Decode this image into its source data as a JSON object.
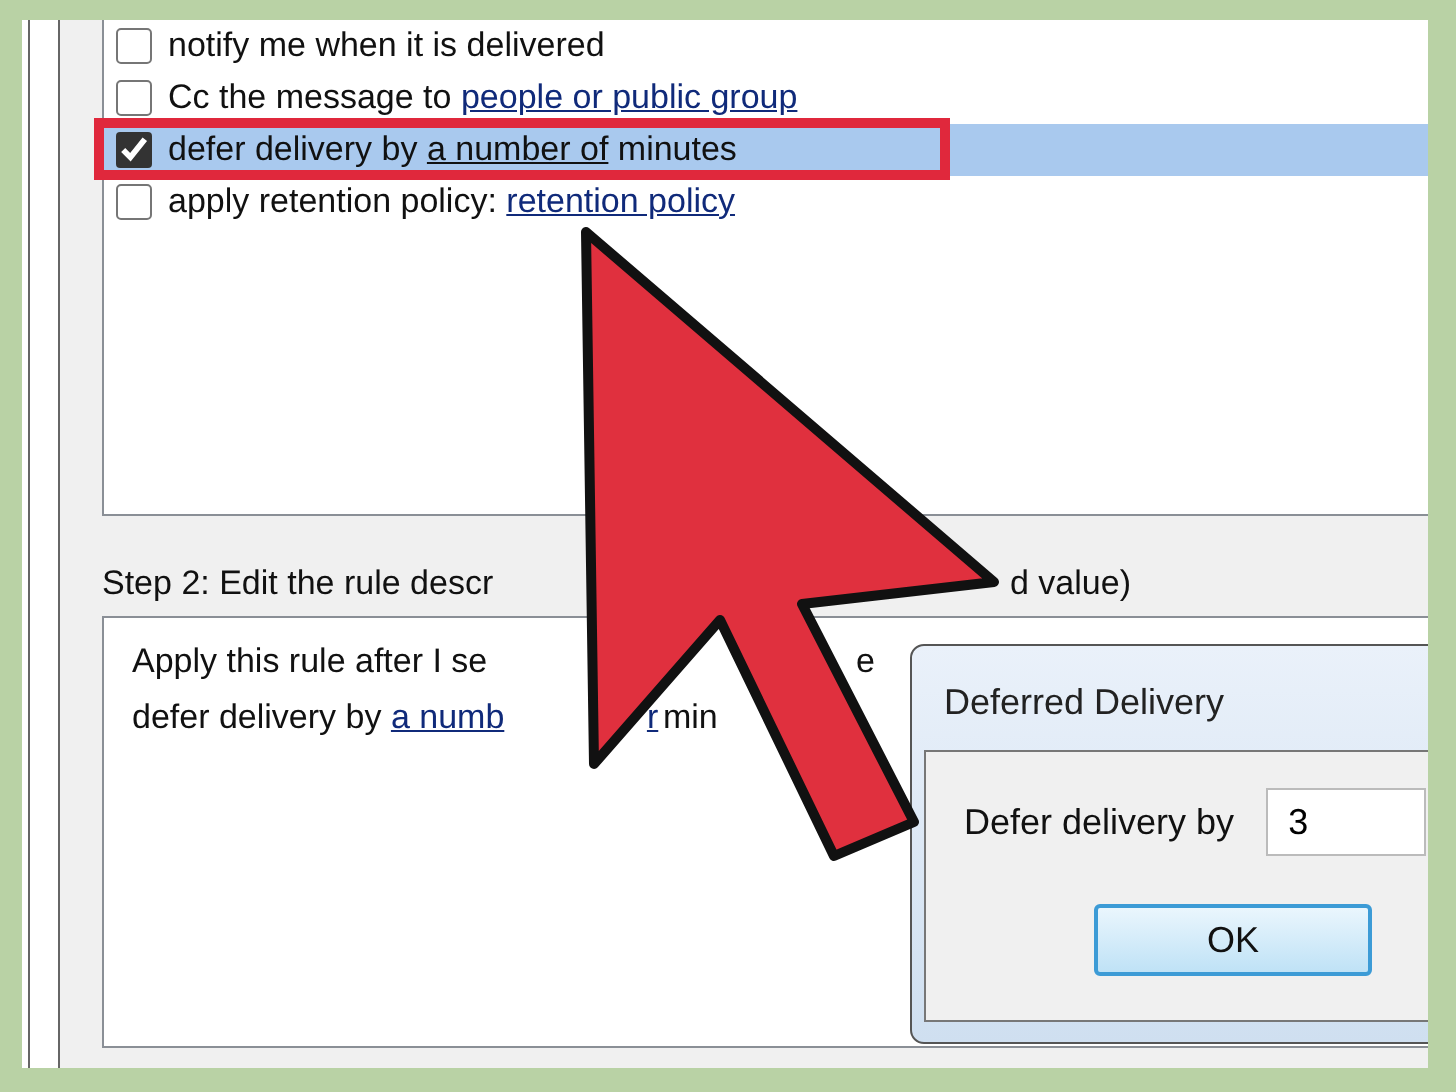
{
  "rules_list": {
    "items": [
      {
        "checked": false,
        "selected": false,
        "parts": [
          {
            "text": "notify me when it is delivered",
            "link": false
          }
        ]
      },
      {
        "checked": false,
        "selected": false,
        "parts": [
          {
            "text": "Cc the message to ",
            "link": false
          },
          {
            "text": "people or public group",
            "link": true
          }
        ]
      },
      {
        "checked": true,
        "selected": true,
        "parts": [
          {
            "text": "defer delivery by ",
            "link": false
          },
          {
            "text": "a number of",
            "link": true
          },
          {
            "text": " minutes",
            "link": false
          }
        ]
      },
      {
        "checked": false,
        "selected": false,
        "parts": [
          {
            "text": "apply retention policy: ",
            "link": false
          },
          {
            "text": "retention policy",
            "link": true
          }
        ]
      }
    ]
  },
  "step2": {
    "label_parts": [
      "Step 2: Edit the rule descr",
      "d value)"
    ]
  },
  "description": {
    "lines": [
      [
        {
          "text": "Apply this rule after I se",
          "link": false
        },
        {
          "text": "e",
          "link": false
        }
      ],
      [
        {
          "text": "defer delivery by ",
          "link": false
        },
        {
          "text": "a numb",
          "link": true
        },
        {
          "text": "r",
          "link": true
        },
        {
          "text": "min",
          "link": false
        }
      ]
    ]
  },
  "dialog": {
    "title": "Deferred Delivery",
    "field_label": "Defer delivery by",
    "value": "3",
    "buttons": [
      "OK"
    ]
  }
}
